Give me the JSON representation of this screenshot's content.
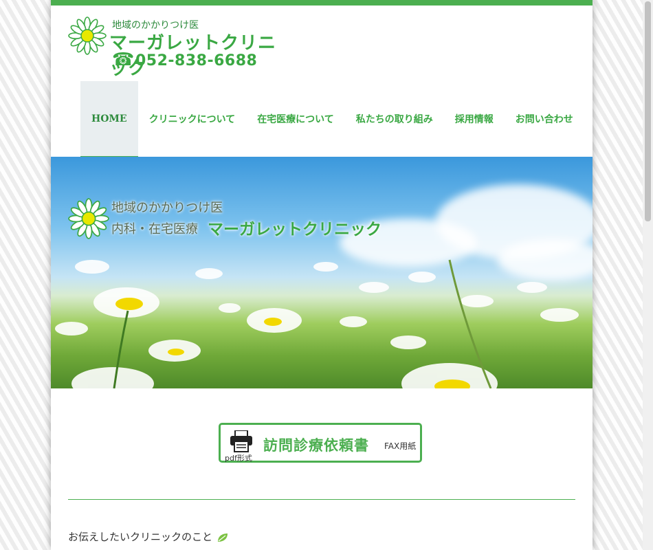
{
  "header": {
    "tagline": "地域のかかりつけ医",
    "clinic_name": "マーガレットクリニック",
    "phone_icon": "☎",
    "phone": "052-838-6688"
  },
  "nav": {
    "items": [
      {
        "label": "HOME"
      },
      {
        "label": "クリニックについて"
      },
      {
        "label": "在宅医療について"
      },
      {
        "label": "私たちの取り組み"
      },
      {
        "label": "採用情報"
      },
      {
        "label": "お問い合わせ"
      }
    ]
  },
  "hero": {
    "tagline": "地域のかかりつけ医",
    "subtitle": "内科・在宅医療",
    "clinic_name": "マーガレットクリニック"
  },
  "fax_button": {
    "label": "訪問診療依頼書",
    "sub": "FAX用紙",
    "format": "pdf形式"
  },
  "section": {
    "title": "お伝えしたいクリニックのこと"
  },
  "colors": {
    "accent": "#4caf50",
    "brand_green": "#3aa843",
    "active_nav_bg": "#e9eef0"
  }
}
